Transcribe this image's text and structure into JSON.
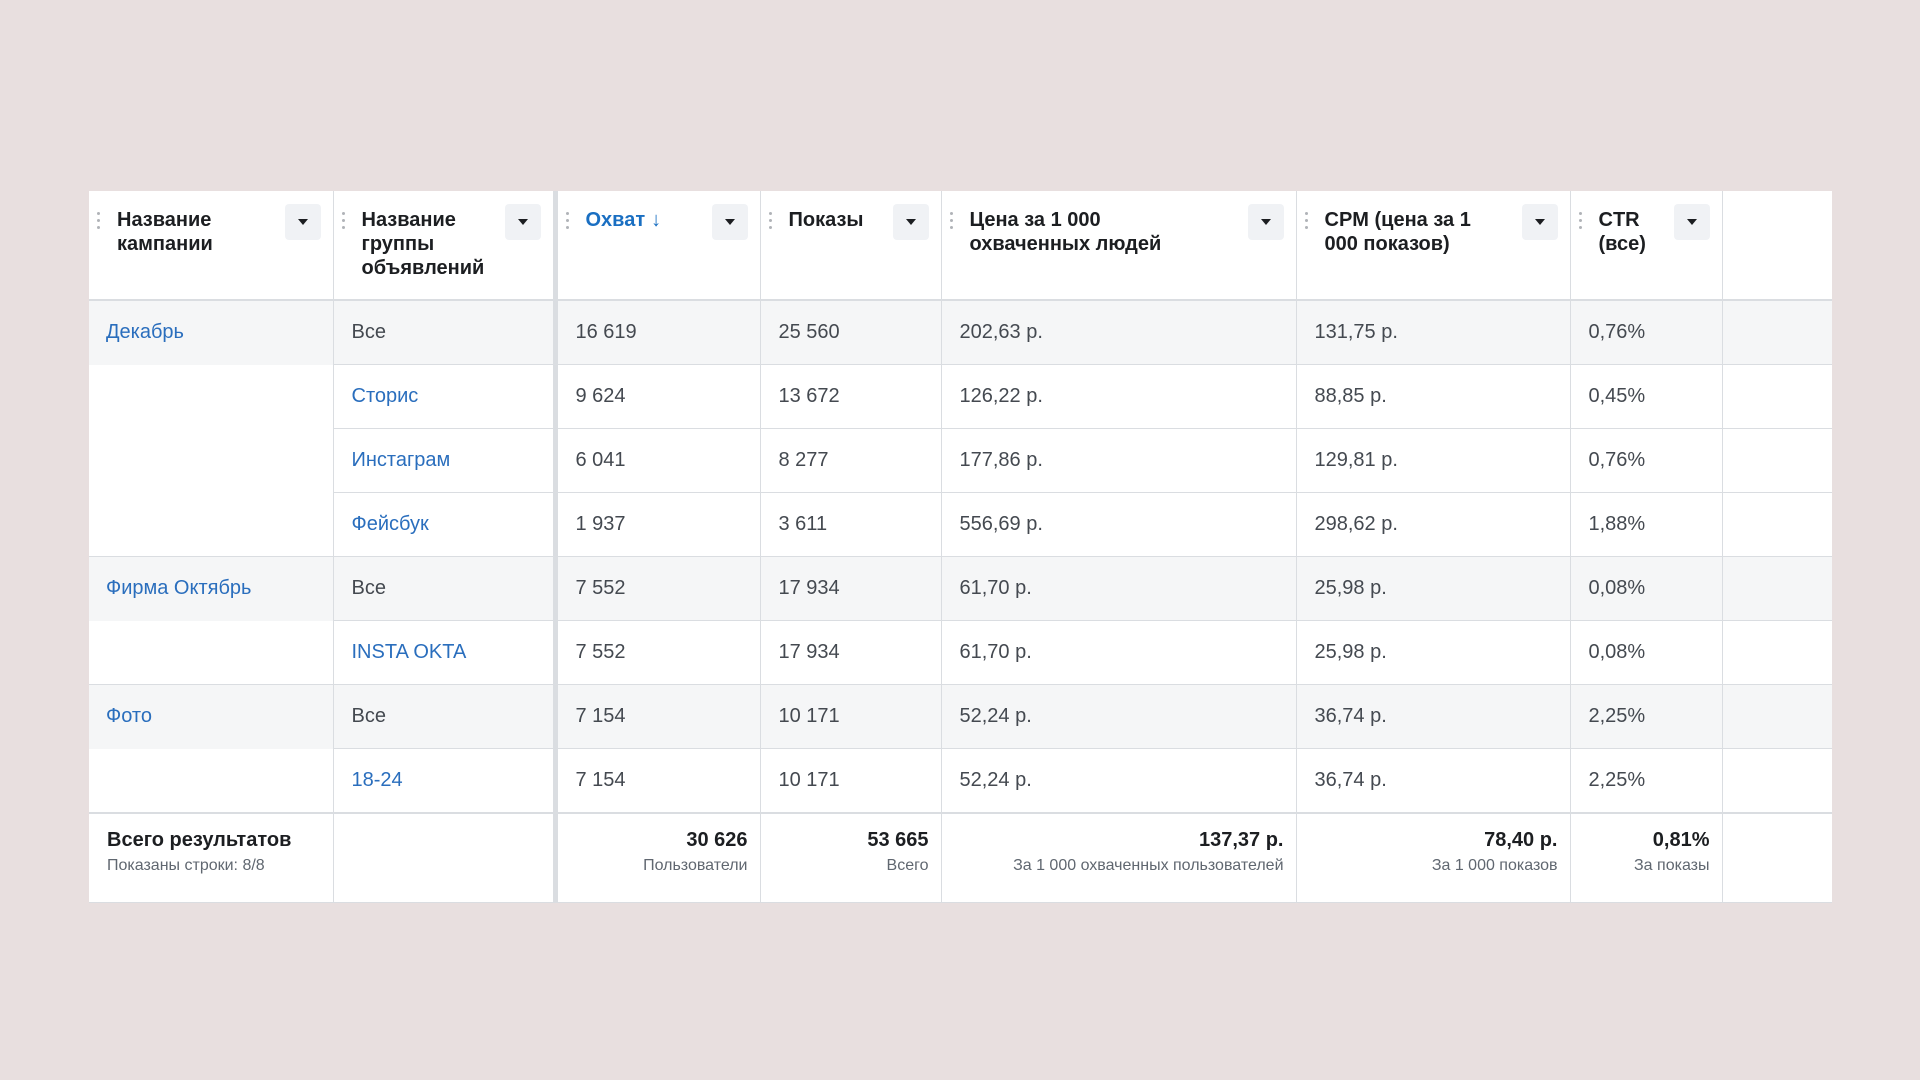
{
  "columns": [
    {
      "label": "Название\nкампании"
    },
    {
      "label": "Название\nгруппы\nобъявлений"
    },
    {
      "label": "Охват",
      "sort": "↓"
    },
    {
      "label": "Показы"
    },
    {
      "label": "Цена за 1 000\nохваченных людей"
    },
    {
      "label": "CPM (цена за 1\n000 показов)"
    },
    {
      "label": "CTR\n(все)"
    }
  ],
  "rows": [
    {
      "campaign": "Декабрь",
      "adset": "Все",
      "reach": "16 619",
      "impressions": "25 560",
      "cost_per_1000": "202,63 р.",
      "cpm": "131,75 р.",
      "ctr": "0,76%"
    },
    {
      "campaign": "",
      "adset": "Сторис",
      "reach": "9 624",
      "impressions": "13 672",
      "cost_per_1000": "126,22 р.",
      "cpm": "88,85 р.",
      "ctr": "0,45%"
    },
    {
      "campaign": "",
      "adset": "Инстаграм",
      "reach": "6 041",
      "impressions": "8 277",
      "cost_per_1000": "177,86 р.",
      "cpm": "129,81 р.",
      "ctr": "0,76%"
    },
    {
      "campaign": "",
      "adset": "Фейсбук",
      "reach": "1 937",
      "impressions": "3 611",
      "cost_per_1000": "556,69 р.",
      "cpm": "298,62 р.",
      "ctr": "1,88%"
    },
    {
      "campaign": "Фирма Октябрь",
      "adset": "Все",
      "reach": "7 552",
      "impressions": "17 934",
      "cost_per_1000": "61,70 р.",
      "cpm": "25,98 р.",
      "ctr": "0,08%"
    },
    {
      "campaign": "",
      "adset": "INSTA OKTA",
      "reach": "7 552",
      "impressions": "17 934",
      "cost_per_1000": "61,70 р.",
      "cpm": "25,98 р.",
      "ctr": "0,08%"
    },
    {
      "campaign": "Фото",
      "adset": "Все",
      "reach": "7 154",
      "impressions": "10 171",
      "cost_per_1000": "52,24 р.",
      "cpm": "36,74 р.",
      "ctr": "2,25%"
    },
    {
      "campaign": "",
      "adset": "18-24",
      "reach": "7 154",
      "impressions": "10 171",
      "cost_per_1000": "52,24 р.",
      "cpm": "36,74 р.",
      "ctr": "2,25%"
    }
  ],
  "totals": {
    "label": "Всего результатов",
    "rows_shown": "Показаны строки: 8/8",
    "reach": "30 626",
    "reach_sub": "Пользователи",
    "impressions": "53 665",
    "impressions_sub": "Всего",
    "cost_per_1000": "137,37 р.",
    "cost_per_1000_sub": "За 1 000 охваченных пользователей",
    "cpm": "78,40 р.",
    "cpm_sub": "За 1 000 показов",
    "ctr": "0,81%",
    "ctr_sub": "За показы"
  },
  "colors": {
    "link": "#2a6ebd",
    "active_header": "#1a6fc2",
    "group_row_bg": "#f5f6f7",
    "page_bg": "#e8dfdf"
  },
  "icons": {
    "dropdown": "caret-down-icon",
    "grip": "drag-handle-icon"
  }
}
